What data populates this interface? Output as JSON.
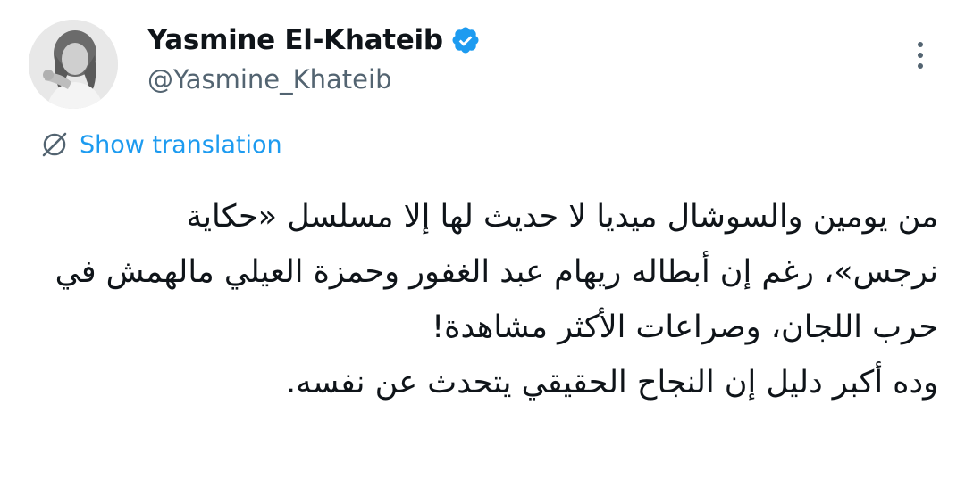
{
  "author": {
    "display_name": "Yasmine El-Khateib",
    "handle": "@Yasmine_Khateib",
    "verified": true,
    "verified_color": "#1d9bf0"
  },
  "icons": {
    "avatar": "profile-photo",
    "verified": "verified-badge-icon",
    "more": "more-vertical-icon",
    "translate": "translate-globe-icon"
  },
  "translation": {
    "label": "Show translation"
  },
  "tweet": {
    "lines": [
      "من يومين والسوشال ميديا لا حديث لها إلا مسلسل «حكاية",
      "نرجس»، رغم إن أبطاله ريهام عبد الغفور وحمزة العيلي مالهمش في",
      "حرب اللجان، وصراعات الأكثر مشاهدة!",
      "وده أكبر دليل إن النجاح الحقيقي يتحدث عن نفسه."
    ]
  },
  "colors": {
    "text": "#0f1419",
    "secondary": "#536471",
    "link": "#1d9bf0"
  }
}
